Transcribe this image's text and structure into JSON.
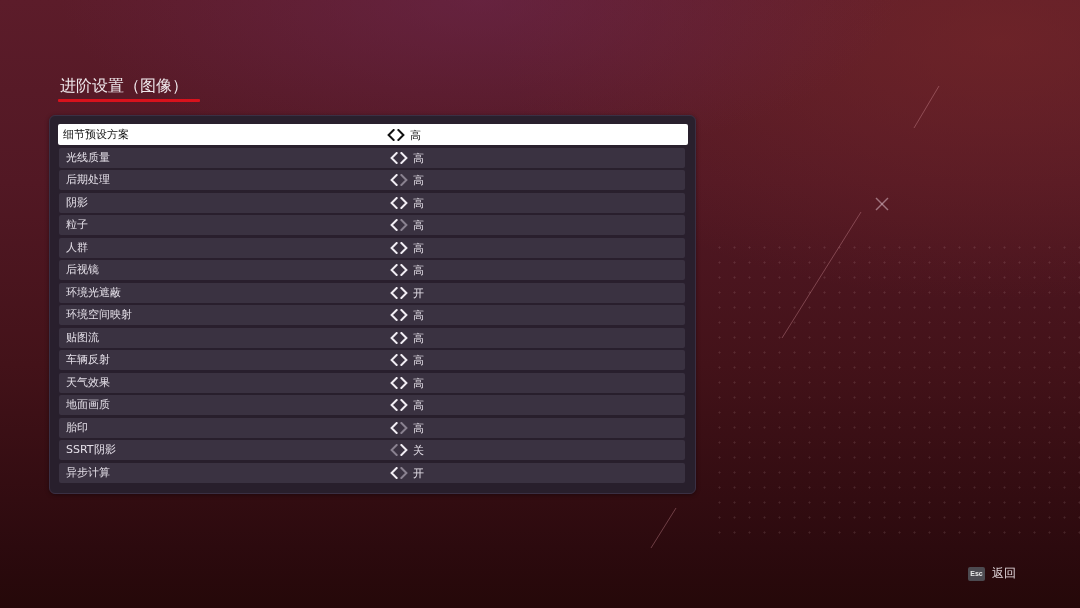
{
  "title": "进阶设置（图像）",
  "settings": [
    {
      "label": "细节预设方案",
      "value": "高",
      "selected": true,
      "prev_disabled": false,
      "next_disabled": false
    },
    {
      "label": "光线质量",
      "value": "高",
      "selected": false,
      "prev_disabled": false,
      "next_disabled": false
    },
    {
      "label": "后期处理",
      "value": "高",
      "selected": false,
      "prev_disabled": false,
      "next_disabled": true
    },
    {
      "label": "阴影",
      "value": "高",
      "selected": false,
      "prev_disabled": false,
      "next_disabled": false
    },
    {
      "label": "粒子",
      "value": "高",
      "selected": false,
      "prev_disabled": false,
      "next_disabled": true
    },
    {
      "label": "人群",
      "value": "高",
      "selected": false,
      "prev_disabled": false,
      "next_disabled": false
    },
    {
      "label": "后视镜",
      "value": "高",
      "selected": false,
      "prev_disabled": false,
      "next_disabled": false
    },
    {
      "label": "环境光遮蔽",
      "value": "开",
      "selected": false,
      "prev_disabled": false,
      "next_disabled": false
    },
    {
      "label": "环境空间映射",
      "value": "高",
      "selected": false,
      "prev_disabled": false,
      "next_disabled": false
    },
    {
      "label": "贴图流",
      "value": "高",
      "selected": false,
      "prev_disabled": false,
      "next_disabled": false
    },
    {
      "label": "车辆反射",
      "value": "高",
      "selected": false,
      "prev_disabled": false,
      "next_disabled": false
    },
    {
      "label": "天气效果",
      "value": "高",
      "selected": false,
      "prev_disabled": false,
      "next_disabled": false
    },
    {
      "label": "地面画质",
      "value": "高",
      "selected": false,
      "prev_disabled": false,
      "next_disabled": false
    },
    {
      "label": "胎印",
      "value": "高",
      "selected": false,
      "prev_disabled": false,
      "next_disabled": true
    },
    {
      "label": "SSRT阴影",
      "value": "关",
      "selected": false,
      "prev_disabled": true,
      "next_disabled": false
    },
    {
      "label": "异步计算",
      "value": "开",
      "selected": false,
      "prev_disabled": false,
      "next_disabled": true
    }
  ],
  "footer": {
    "key": "Esc",
    "action": "返回"
  }
}
